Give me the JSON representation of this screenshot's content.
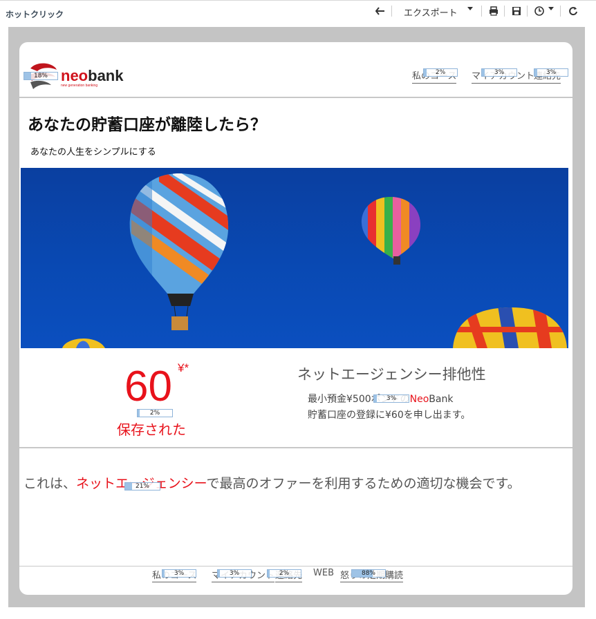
{
  "toolbar": {
    "title": "ホットクリック",
    "export_label": "エクスポート",
    "icons": [
      "back-icon",
      "print-icon",
      "save-icon",
      "clock-icon",
      "refresh-icon"
    ]
  },
  "header": {
    "logo_brand_neo": "neo",
    "logo_brand_bank": "bank",
    "logo_tagline": "new generation banking",
    "logo_heat": "18%",
    "nav": [
      {
        "label": "私のコース",
        "heat": "2%"
      },
      {
        "label": "マイアカウント",
        "heat": "3%"
      },
      {
        "label": "連絡先",
        "heat": "3%"
      }
    ]
  },
  "hero": {
    "title": "あなたの貯蓄口座が離陸したら？",
    "subtitle": "あなたの人生をシンプルにする"
  },
  "promo": {
    "amount": "60",
    "currency": "¥*",
    "amount_heat": "2%",
    "saved_label": "保存された",
    "agency_title": "ネットエージェンシー排他性",
    "line1_prefix": "最小預金¥500ポンドの",
    "line1_neo": "Neo",
    "line1_bank": "Bank",
    "line1_heat": "3%",
    "line2": "貯蓄口座の登録に¥60を申し出ます。"
  },
  "offer": {
    "prefix": "これは、",
    "highlight": "ネットエージェンシー",
    "suffix": "で最高のオファーを利用するための適切な機会です。",
    "heat": "21%"
  },
  "footer": {
    "links": [
      {
        "label": "私のコース",
        "heat": "3%"
      },
      {
        "label": "マイアカウント",
        "heat": "3%"
      },
      {
        "label": "連絡先",
        "heat": "2%"
      },
      {
        "label": "WEB",
        "heat": ""
      },
      {
        "label": "怒りの定期購読",
        "heat": "88%"
      }
    ]
  },
  "colors": {
    "brand_red": "#e8121b",
    "sky_blue": "#0949b3",
    "heat_border": "#8fb4d9"
  }
}
